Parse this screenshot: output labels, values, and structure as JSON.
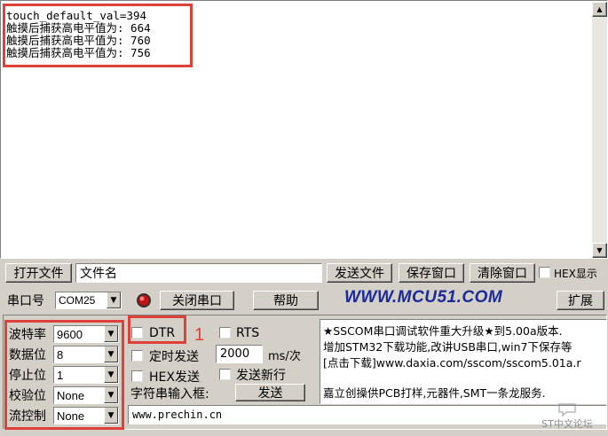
{
  "terminal": {
    "lines": [
      "touch_default_val=394",
      "触摸后捕获高电平值为: 664",
      "触摸后捕获高电平值为: 760",
      "触摸后捕获高电平值为: 756"
    ]
  },
  "file_row": {
    "open_file": "打开文件",
    "file_name": "文件名",
    "send_file": "发送文件",
    "save_window": "保存窗口",
    "clear_window": "清除窗口",
    "hex_display": "HEX显示"
  },
  "port_row": {
    "port_label": "串口号",
    "port_value": "COM25",
    "close_port": "关闭串口",
    "help": "帮助",
    "url": "WWW.MCU51.COM",
    "expand": "扩展"
  },
  "settings": {
    "baud_label": "波特率",
    "baud_value": "9600",
    "data_label": "数据位",
    "data_value": "8",
    "stop_label": "停止位",
    "stop_value": "1",
    "parity_label": "校验位",
    "parity_value": "None",
    "flow_label": "流控制",
    "flow_value": "None"
  },
  "controls": {
    "dtr": "DTR",
    "rts": "RTS",
    "annotation": "1",
    "timed_send": "定时发送",
    "interval": "2000",
    "interval_unit": "ms/次",
    "hex_send": "HEX发送",
    "send_newline": "发送新行",
    "input_label": "字符串输入框:",
    "send": "发送"
  },
  "info": {
    "line1": "★SSCOM串口调试软件重大升级★到5.00a版本.",
    "line2": "增加STM32下载功能,改讲USB串口,win7下保存等",
    "line3": "[点击下载]www.daxia.com/sscom/sscom5.01a.r",
    "line4": "嘉立创操供PCB打样,元器件,SMT一条龙服务."
  },
  "input_value": "www.prechin.cn",
  "watermark": "ST中文论坛",
  "colors": {
    "annotation_red": "#e0403a",
    "url_blue": "#1a2a9a"
  }
}
